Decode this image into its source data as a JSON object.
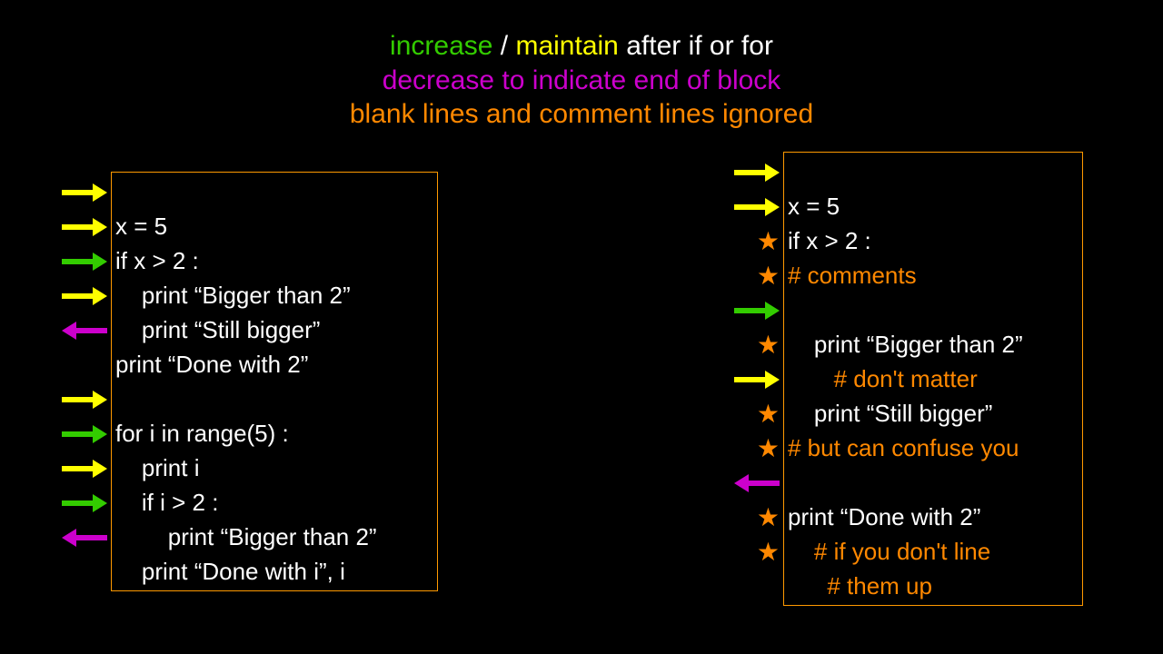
{
  "header": {
    "l1a": "increase",
    "l1b": " / ",
    "l1c": "maintain",
    "l1d": " after if or for",
    "l2": "decrease to indicate end of block",
    "l3": "blank lines and comment lines ignored"
  },
  "left": {
    "c0": "x = 5",
    "c1": "if x > 2 :",
    "c2": "    print “Bigger than 2”",
    "c3": "    print “Still bigger”",
    "c4": "print “Done with 2”",
    "c5": " ",
    "c6": "for i in range(5) :",
    "c7": "    print i",
    "c8": "    if i > 2 :",
    "c9": "        print “Bigger than 2”",
    "c10": "    print “Done with i”, i"
  },
  "right": {
    "c0": "x = 5",
    "c1": "if x > 2 :",
    "c2": "# comments",
    "c3": " ",
    "c4": "    print “Bigger than 2”",
    "c5": "       # don't matter",
    "c6": "    print “Still bigger”",
    "c7": "# but can confuse you",
    "c8": " ",
    "c9": "print “Done with 2”",
    "c10": "    # if you don't line",
    "c11": "      # them up"
  },
  "markers_left": [
    "ry",
    "ry",
    "rg",
    "ry",
    "lm",
    "-",
    "ry",
    "rg",
    "ry",
    "rg",
    "lm"
  ],
  "markers_right": [
    "ry",
    "ry",
    "st",
    "st",
    "rg",
    "st",
    "ry",
    "st",
    "st",
    "lm",
    "st",
    "st"
  ]
}
